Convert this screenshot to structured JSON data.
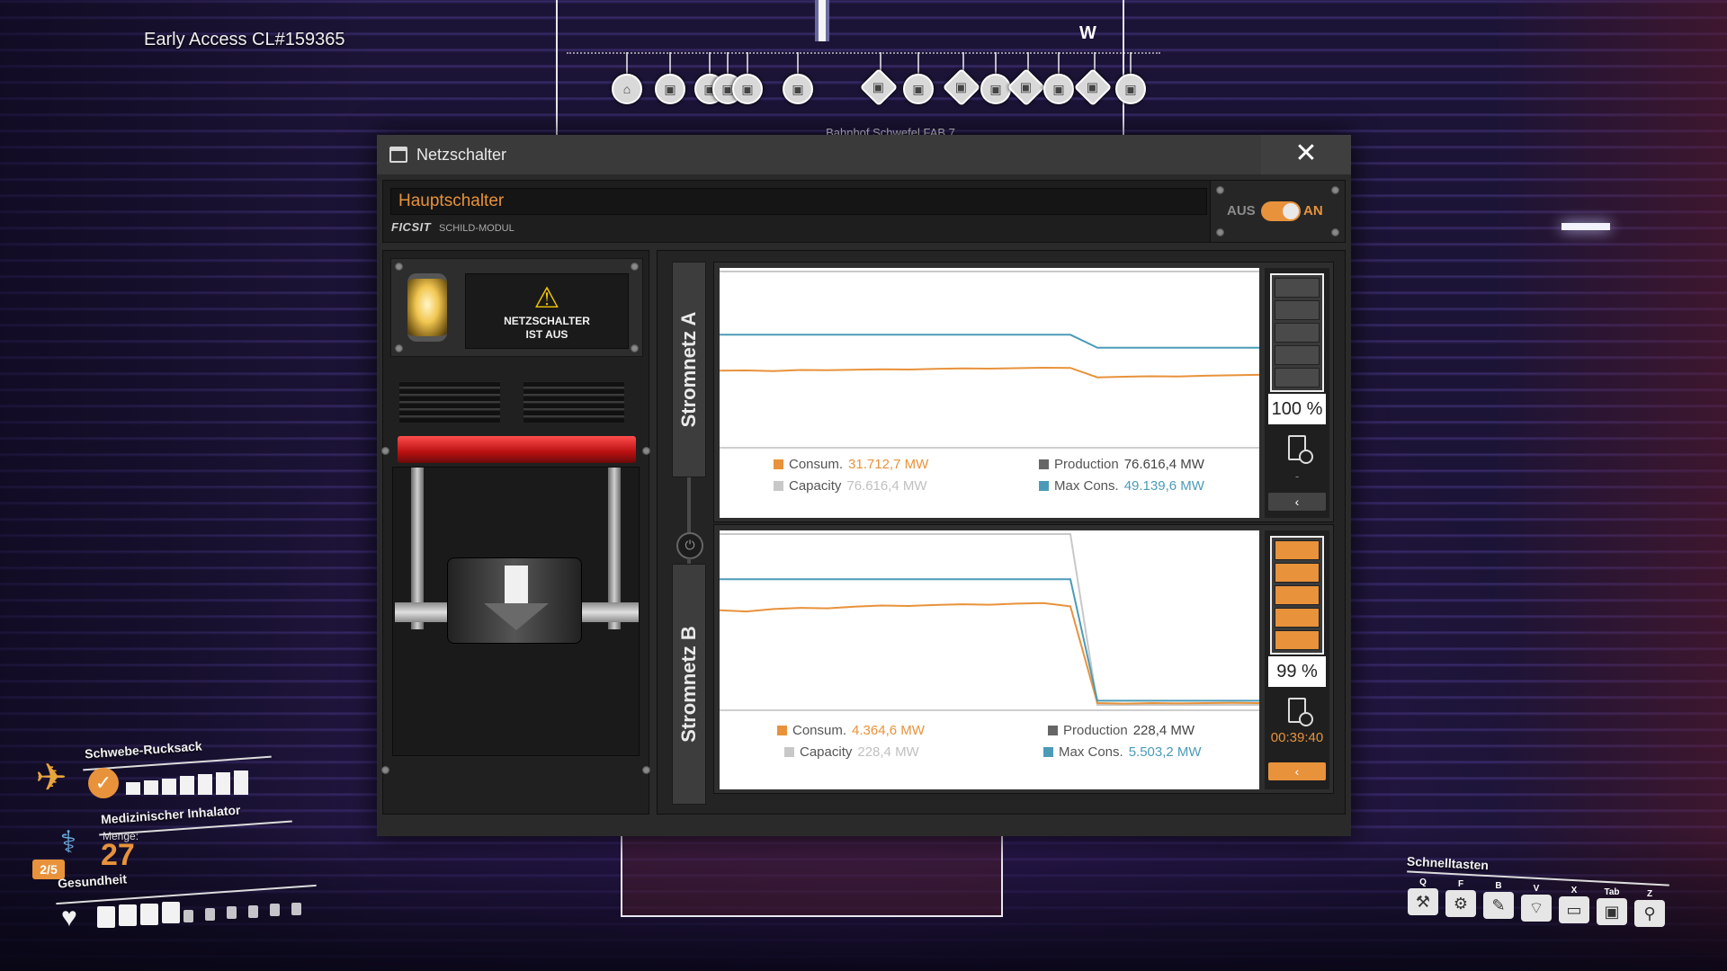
{
  "version_text": "Early Access CL#159365",
  "compass": {
    "direction": "W",
    "target_label": "Bahnhof Schwefel FAB 7",
    "icons": [
      "station-icon",
      "train-icon",
      "train-icon",
      "train-icon",
      "train-icon",
      "train-icon",
      "train-icon",
      "train-icon",
      "train-icon",
      "train-icon",
      "train-icon",
      "train-icon",
      "train-icon",
      "train-icon",
      "train-icon",
      "train-icon"
    ]
  },
  "window": {
    "title": "Netzschalter",
    "close_glyph": "✕",
    "switch_name": "Hauptschalter",
    "brand": "FICSIT",
    "module": "SCHILD-MODUL",
    "toggle_off_label": "AUS",
    "toggle_on_label": "AN",
    "toggle_state": "on"
  },
  "switch_panel": {
    "warning_line1": "NETZSCHALTER",
    "warning_line2": "IST AUS",
    "lamp_color": "#f2c651",
    "lever_color": "#d81f1f"
  },
  "colors": {
    "consumption": "#e8923b",
    "production": "#666666",
    "capacity": "#c8c8c8",
    "max_consumption": "#4b9bb8",
    "accent": "#e8923b"
  },
  "circuit_a": {
    "label": "Stromnetz A",
    "legend": {
      "consumption_label": "Consum.",
      "consumption_value": "31.712,7 MW",
      "production_label": "Production",
      "production_value": "76.616,4 MW",
      "capacity_label": "Capacity",
      "capacity_value": "76.616,4 MW",
      "max_label": "Max Cons.",
      "max_value": "49.139,6 MW"
    },
    "battery_percent": "100 %",
    "battery_fill": 0,
    "battery_status": "-",
    "expand_glyph": "‹"
  },
  "circuit_b": {
    "label": "Stromnetz B",
    "legend": {
      "consumption_label": "Consum.",
      "consumption_value": "4.364,6 MW",
      "production_label": "Production",
      "production_value": "228,4 MW",
      "capacity_label": "Capacity",
      "capacity_value": "228,4 MW",
      "max_label": "Max Cons.",
      "max_value": "5.503,2 MW"
    },
    "battery_percent": "99 %",
    "battery_fill": 0.99,
    "battery_time": "00:39:40",
    "expand_glyph": "‹"
  },
  "hud": {
    "jetpack_label": "Schwebe-Rucksack",
    "jetpack_fuel_segments": 7,
    "inhaler_label": "Medizinischer Inhalator",
    "inhaler_count": "2/5",
    "quantity_label": "Menge:",
    "quantity_value": "27",
    "health_label": "Gesundheit",
    "health_segments_total": 10,
    "health_segments_filled": 4
  },
  "hotkeys": {
    "title": "Schnelltasten",
    "items": [
      {
        "key": "Q",
        "icon": "hammer-icon",
        "glyph": "⚒"
      },
      {
        "key": "F",
        "icon": "dismantle-icon",
        "glyph": "⚙"
      },
      {
        "key": "B",
        "icon": "build-gun-icon",
        "glyph": "✎"
      },
      {
        "key": "V",
        "icon": "scanner-icon",
        "glyph": "⌔"
      },
      {
        "key": "X",
        "icon": "inventory-icon",
        "glyph": "▭"
      },
      {
        "key": "Tab",
        "icon": "codex-icon",
        "glyph": "▣"
      },
      {
        "key": "Z",
        "icon": "map-icon",
        "glyph": "⚲"
      }
    ]
  },
  "chart_data": [
    {
      "type": "line",
      "title": "Stromnetz A",
      "x": [
        0,
        1,
        2,
        3,
        4,
        5,
        6,
        7,
        8,
        9,
        10,
        11,
        12,
        13,
        14,
        15,
        16,
        17,
        18,
        19,
        20
      ],
      "series": [
        {
          "name": "Max Cons.",
          "values": [
            49139,
            49139,
            49139,
            49139,
            49139,
            49139,
            49139,
            49139,
            49139,
            49139,
            49139,
            49139,
            49139,
            49139,
            43500,
            43500,
            43500,
            43500,
            43500,
            43500,
            43500
          ]
        },
        {
          "name": "Consum.",
          "values": [
            33500,
            33600,
            33300,
            33800,
            33700,
            33900,
            34100,
            34000,
            34300,
            34500,
            34400,
            34600,
            34800,
            34700,
            30600,
            30900,
            31100,
            31000,
            31300,
            31500,
            31712
          ]
        },
        {
          "name": "Capacity",
          "values": [
            76616,
            76616,
            76616,
            76616,
            76616,
            76616,
            76616,
            76616,
            76616,
            76616,
            76616,
            76616,
            76616,
            76616,
            76616,
            76616,
            76616,
            76616,
            76616,
            76616,
            76616
          ]
        }
      ],
      "ylim": [
        0,
        76616
      ]
    },
    {
      "type": "line",
      "title": "Stromnetz B",
      "x": [
        0,
        1,
        2,
        3,
        4,
        5,
        6,
        7,
        8,
        9,
        10,
        11,
        12,
        13,
        14,
        15,
        16,
        17,
        18,
        19,
        20
      ],
      "series": [
        {
          "name": "Max Cons.",
          "values": [
            5503,
            5503,
            5503,
            5503,
            5503,
            5503,
            5503,
            5503,
            5503,
            5503,
            5503,
            5503,
            5503,
            5503,
            400,
            400,
            400,
            400,
            400,
            400,
            400
          ]
        },
        {
          "name": "Consum.",
          "values": [
            4200,
            4150,
            4250,
            4300,
            4280,
            4350,
            4400,
            4380,
            4420,
            4450,
            4430,
            4480,
            4500,
            4364,
            300,
            280,
            300,
            290,
            300,
            310,
            300
          ]
        },
        {
          "name": "Capacity",
          "values": [
            7400,
            7400,
            7400,
            7400,
            7400,
            7400,
            7400,
            7400,
            7400,
            7400,
            7400,
            7400,
            7400,
            7400,
            228,
            228,
            228,
            228,
            228,
            228,
            228
          ]
        }
      ],
      "ylim": [
        0,
        7400
      ]
    }
  ]
}
